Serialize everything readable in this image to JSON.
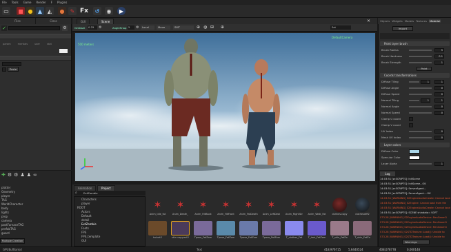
{
  "menu": [
    "File",
    "Tools",
    "Game",
    "Render",
    "F",
    "Plugins"
  ],
  "toolbar": {
    "fx_label": "Fx"
  },
  "left_panel": {
    "tabs": [
      "Files",
      "Class"
    ],
    "fields": [
      "param",
      "mentals",
      "user",
      "stat"
    ],
    "paste_label": "Paste",
    "hierarchy_items": [
      "platter",
      "Geometry",
      "player",
      "TAG",
      "WorldCharacter",
      "body",
      "lights",
      "prop",
      "camera",
      "postFurnaceTAG",
      "prefabTAG",
      "guard"
    ],
    "edit_label": "Multiple Creation"
  },
  "viewport": {
    "tabs": [
      "GUI",
      "Scene"
    ],
    "toolbar": {
      "gridsize_label": "Gridsize",
      "gridsize_value": "0.25",
      "angle_label": "AngleSnap",
      "angle_value": "5",
      "local_label": "Local",
      "move_label": "Move",
      "view_label": "SMT",
      "zoom_label": "Sat"
    },
    "overlay_left": "500 meters",
    "overlay_right": "DefaultCamera"
  },
  "bottom": {
    "tabs": [
      "Animation",
      "Project"
    ],
    "search_value": "ExtZombie",
    "folders": [
      "Characters",
      "player",
      "ROOT",
      "Actors",
      "Default",
      "detail",
      "ExtZombie",
      "Fonts",
      "FPS",
      "FPS_template",
      "GUI"
    ],
    "assets_row1": [
      "Anim_Idle_fat",
      "Anim_Death_",
      "Anim_HitBack",
      "Anim_HitFront",
      "Anim_FatDeath",
      "Anim_LeftDeal",
      "Anim_RightStr",
      "Anim_Walk_Fat",
      "clothes.copy",
      "clothesdiff2"
    ],
    "assets_row2": [
      "hulcot2",
      "skin copy.ext2",
      "Tpose_FatZom",
      "Tpose_FatZom",
      "Tpose_FatZom",
      "Tpose_FatZom",
      "T_clothes_Fat",
      "T_hair_FatZom",
      "T_skin_FatZo",
      "T_skin_FatZo"
    ]
  },
  "right_panel": {
    "tabs": [
      "Objects",
      "Widgets",
      "Models",
      "Textures",
      "Material"
    ],
    "import_label": "Import",
    "paint_section": "Paint layer brush",
    "paint_props": [
      {
        "label": "Brush Radius",
        "value": "5"
      },
      {
        "label": "Brush Hardness",
        "value": "0.1"
      },
      {
        "label": "Brush Strength",
        "value": "1"
      }
    ],
    "paint_button": "Paint",
    "coords_section": "Coords transformations",
    "coord_props": [
      {
        "label": "Diffuse Tiling",
        "value": "1",
        "value2": "1"
      },
      {
        "label": "Diffuse Angle",
        "value": "0"
      },
      {
        "label": "Diffuse Speed",
        "value": "0"
      },
      {
        "label": "Normal Tiling",
        "value": "1",
        "value2": "1"
      },
      {
        "label": "Normal Angle",
        "value": "0"
      },
      {
        "label": "Normal Speed",
        "value": "0"
      },
      {
        "label": "Clamp U coord",
        "value": ""
      },
      {
        "label": "Clamp V coord",
        "value": ""
      },
      {
        "label": "UV Index",
        "value": "0"
      },
      {
        "label": "Mesh UV Index",
        "value": "0"
      }
    ],
    "colors_section": "Layer colors",
    "color_props": [
      {
        "label": "Diffuse Color",
        "color": "#a9d4e6"
      },
      {
        "label": "Specular Color",
        "color": "#ffffff"
      },
      {
        "label": "Layer Alpha",
        "value": "1"
      }
    ]
  },
  "log": {
    "title": "Log",
    "lines": [
      {
        "text": "14:03:51 [w:SCRIPTS]: InitScene",
        "color": "#dddddd"
      },
      {
        "text": "14:03:51 [w:SCRIPTS]: InitScene...OK",
        "color": "#dddddd"
      },
      {
        "text": "14:03:51 [w:SCRIPTS]: ServerAgent...",
        "color": "#dddddd"
      },
      {
        "text": "14:03:51 [w:SCRIPTS]: ServerAgent....OK",
        "color": "#dddddd"
      },
      {
        "text": "14:03:51 [WARNING] S2EngineAudioCreate: Cannot load",
        "color": "#e0552e"
      },
      {
        "text": "14:03:51 [WARNING] S2Engine: Cannot load from file",
        "color": "#e0552e"
      },
      {
        "text": "14:03:51 [WARNING] S2EngineAudioCreate: Cannot load",
        "color": "#e0552e"
      },
      {
        "text": "14:03:51 [w:SCRIPTS]: SCENE shindata= SOFT",
        "color": "#dddddd"
      },
      {
        "text": "S73.28 [WARNING] S2EngineAudioDevice: RenGeom3",
        "color": "#e0552e"
      },
      {
        "text": "S73.28 [WARNING] S2EngineAudioDevice: RenGeom3",
        "color": "#e0552e"
      },
      {
        "text": "S73.28 [WARNING] S2EngineAudioDevice: RenGeom3",
        "color": "#e0552e"
      },
      {
        "text": "S73.28 [WARNING] S2STDTexture::Load(): Unable to",
        "color": "#e0552e"
      },
      {
        "text": "S73.28 [WARNING] S2STDTexture::Load(): Unable to",
        "color": "#e0552e"
      }
    ],
    "warnings_label": "Warnings"
  },
  "status": {
    "left": "GPUBufBankd",
    "mid": "Text",
    "coords1": "418,976715",
    "coords2": "5,6440524",
    "right1": "408,078778",
    "right2": "0,000148"
  },
  "colors": {
    "accent": "#4a8fd8",
    "warning": "#e0552e",
    "sky": "#8fb1cc"
  }
}
